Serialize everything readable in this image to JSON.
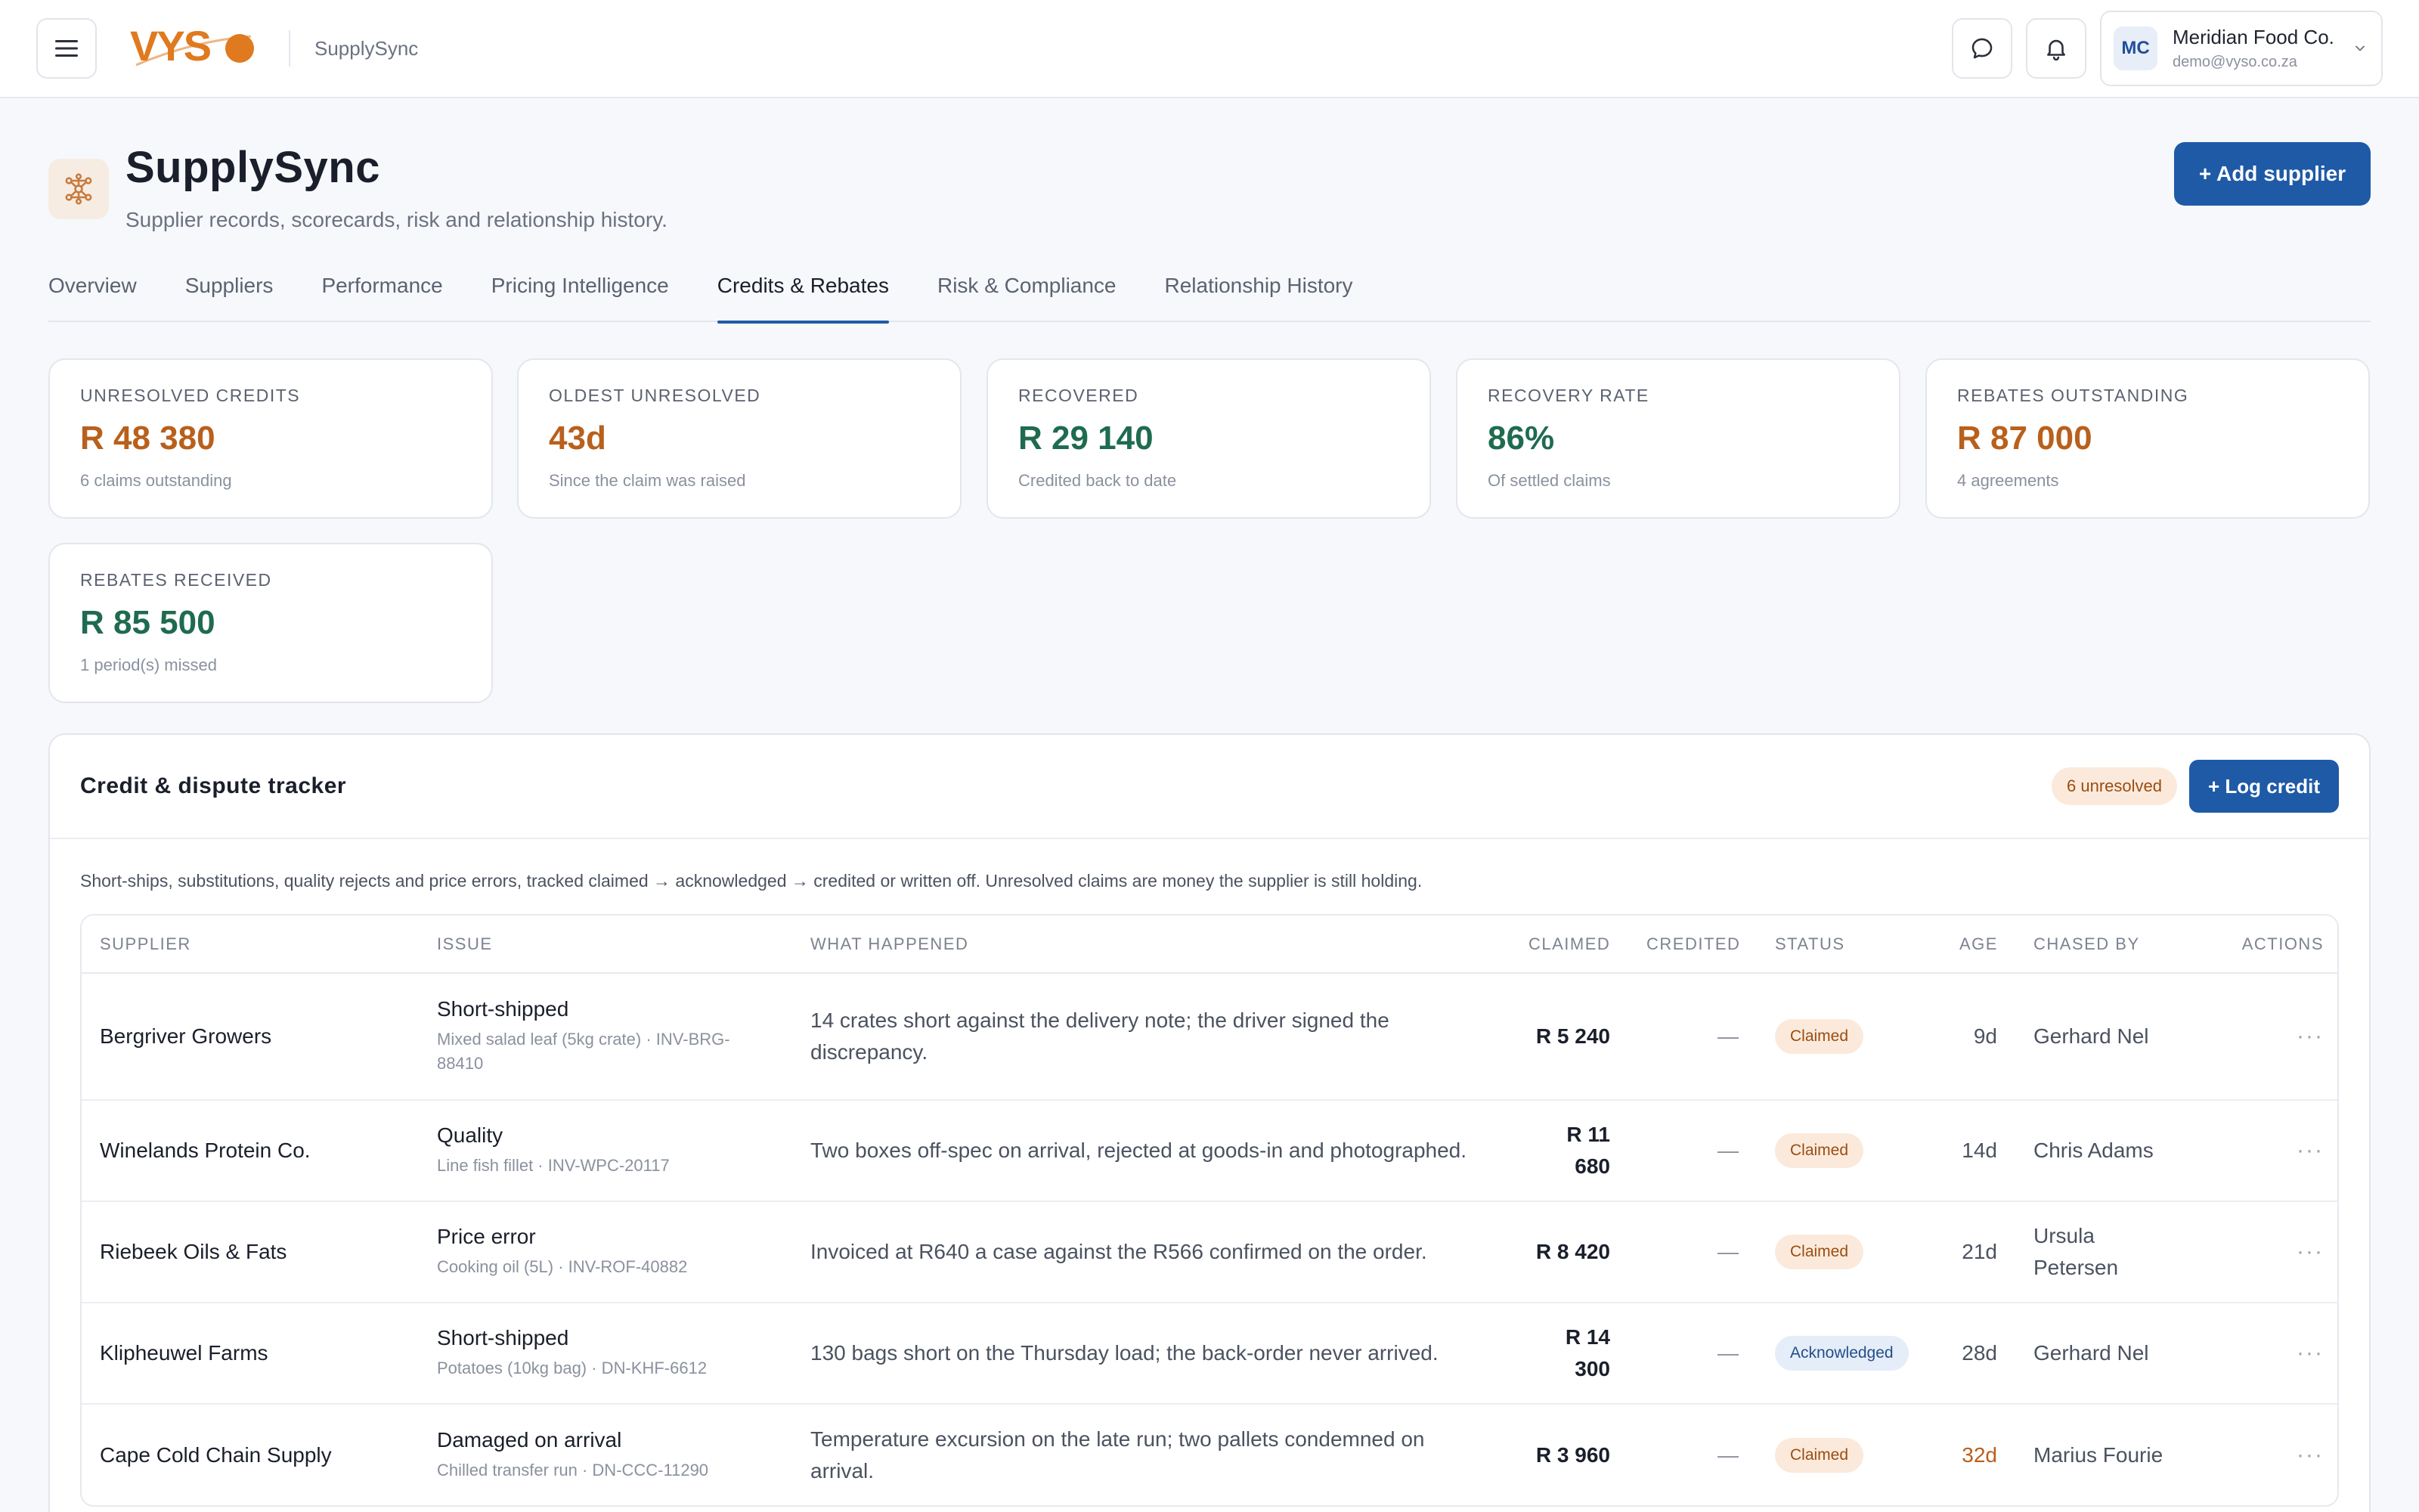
{
  "topbar": {
    "logo_text": "VYSO",
    "app_name": "SupplySync",
    "account": {
      "initials": "MC",
      "name": "Meridian Food Co.",
      "email": "demo@vyso.co.za"
    }
  },
  "header": {
    "title": "SupplySync",
    "subtitle": "Supplier records, scorecards, risk and relationship history.",
    "add_supplier_label": "+ Add supplier"
  },
  "tabs": [
    {
      "label": "Overview"
    },
    {
      "label": "Suppliers"
    },
    {
      "label": "Performance"
    },
    {
      "label": "Pricing Intelligence"
    },
    {
      "label": "Credits & Rebates"
    },
    {
      "label": "Risk & Compliance"
    },
    {
      "label": "Relationship History"
    }
  ],
  "active_tab": "Credits & Rebates",
  "kpis": [
    {
      "label": "Unresolved credits",
      "value": "R 48 380",
      "note": "6 claims outstanding"
    },
    {
      "label": "Oldest unresolved",
      "value": "43d",
      "note": "Since the claim was raised"
    },
    {
      "label": "Recovered",
      "value": "R 29 140",
      "note": "Credited back to date"
    },
    {
      "label": "Recovery rate",
      "value": "86%",
      "note": "Of settled claims"
    },
    {
      "label": "Rebates outstanding",
      "value": "R 87 000",
      "note": "4 agreements"
    },
    {
      "label": "Rebates received",
      "value": "R 85 500",
      "note": "1 period(s) missed"
    }
  ],
  "tracker": {
    "title": "Credit & dispute tracker",
    "unresolved_badge": "6 unresolved",
    "log_credit_label": "+ Log credit",
    "description": "Short-ships, substitutions, quality rejects and price errors, tracked claimed → acknowledged → credited or written off. Unresolved claims are money the supplier is still holding.",
    "columns": {
      "supplier": "Supplier",
      "issue": "Issue",
      "what": "What happened",
      "claimed": "Claimed",
      "credited": "Credited",
      "status": "Status",
      "age": "Age",
      "chased": "Chased by",
      "actions": "Actions"
    },
    "rows": [
      {
        "supplier": "Bergriver Growers",
        "issue_type": "Short-shipped",
        "issue_detail": "Mixed salad leaf (5kg crate) · INV-BRG-88410",
        "what": "14 crates short against the delivery note; the driver signed the discrepancy.",
        "claimed": "R 5 240",
        "credited": "—",
        "status": "Claimed",
        "age": "9d",
        "chased_by": "Gerhard Nel",
        "actions": "···"
      },
      {
        "supplier": "Winelands Protein Co.",
        "issue_type": "Quality",
        "issue_detail": "Line fish fillet · INV-WPC-20117",
        "what": "Two boxes off-spec on arrival, rejected at goods-in and photographed.",
        "claimed": "R 11 680",
        "credited": "—",
        "status": "Claimed",
        "age": "14d",
        "chased_by": "Chris Adams",
        "actions": "···"
      },
      {
        "supplier": "Riebeek Oils & Fats",
        "issue_type": "Price error",
        "issue_detail": "Cooking oil (5L) · INV-ROF-40882",
        "what": "Invoiced at R640 a case against the R566 confirmed on the order.",
        "claimed": "R 8 420",
        "credited": "—",
        "status": "Claimed",
        "age": "21d",
        "chased_by": "Ursula Petersen",
        "actions": "···"
      },
      {
        "supplier": "Klipheuwel Farms",
        "issue_type": "Short-shipped",
        "issue_detail": "Potatoes (10kg bag) · DN-KHF-6612",
        "what": "130 bags short on the Thursday load; the back-order never arrived.",
        "claimed": "R 14 300",
        "credited": "—",
        "status": "Acknowledged",
        "age": "28d",
        "chased_by": "Gerhard Nel",
        "actions": "···"
      },
      {
        "supplier": "Cape Cold Chain Supply",
        "issue_type": "Damaged on arrival",
        "issue_detail": "Chilled transfer run · DN-CCC-11290",
        "what": "Temperature excursion on the late run; two pallets condemned on arrival.",
        "claimed": "R 3 960",
        "credited": "—",
        "status": "Claimed",
        "age": "32d",
        "chased_by": "Marius Fourie",
        "actions": "···"
      }
    ]
  },
  "colors": {
    "primary": "#1f5aa6",
    "brand_orange": "#e07a1f",
    "warn_value": "#b8601c",
    "good_value": "#1f6b50"
  },
  "icons": {
    "menu": "hamburger-icon",
    "chat": "chat-bubble-icon",
    "notifications": "bell-icon",
    "chevron": "chevron-down-icon",
    "page": "network-nodes-icon"
  }
}
